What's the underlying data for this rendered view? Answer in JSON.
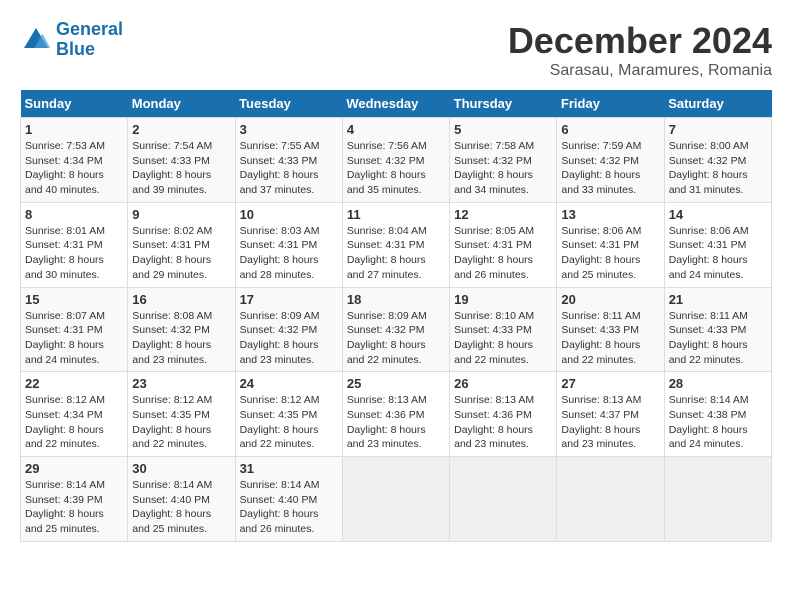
{
  "header": {
    "logo_line1": "General",
    "logo_line2": "Blue",
    "title": "December 2024",
    "subtitle": "Sarasau, Maramures, Romania"
  },
  "calendar": {
    "days_of_week": [
      "Sunday",
      "Monday",
      "Tuesday",
      "Wednesday",
      "Thursday",
      "Friday",
      "Saturday"
    ],
    "weeks": [
      [
        {
          "day": "",
          "detail": ""
        },
        {
          "day": "2",
          "detail": "Sunrise: 7:54 AM\nSunset: 4:33 PM\nDaylight: 8 hours\nand 39 minutes."
        },
        {
          "day": "3",
          "detail": "Sunrise: 7:55 AM\nSunset: 4:33 PM\nDaylight: 8 hours\nand 37 minutes."
        },
        {
          "day": "4",
          "detail": "Sunrise: 7:56 AM\nSunset: 4:32 PM\nDaylight: 8 hours\nand 35 minutes."
        },
        {
          "day": "5",
          "detail": "Sunrise: 7:58 AM\nSunset: 4:32 PM\nDaylight: 8 hours\nand 34 minutes."
        },
        {
          "day": "6",
          "detail": "Sunrise: 7:59 AM\nSunset: 4:32 PM\nDaylight: 8 hours\nand 33 minutes."
        },
        {
          "day": "7",
          "detail": "Sunrise: 8:00 AM\nSunset: 4:32 PM\nDaylight: 8 hours\nand 31 minutes."
        }
      ],
      [
        {
          "day": "1",
          "detail": "Sunrise: 7:53 AM\nSunset: 4:34 PM\nDaylight: 8 hours\nand 40 minutes."
        },
        null,
        null,
        null,
        null,
        null,
        null
      ],
      [
        {
          "day": "8",
          "detail": "Sunrise: 8:01 AM\nSunset: 4:31 PM\nDaylight: 8 hours\nand 30 minutes."
        },
        {
          "day": "9",
          "detail": "Sunrise: 8:02 AM\nSunset: 4:31 PM\nDaylight: 8 hours\nand 29 minutes."
        },
        {
          "day": "10",
          "detail": "Sunrise: 8:03 AM\nSunset: 4:31 PM\nDaylight: 8 hours\nand 28 minutes."
        },
        {
          "day": "11",
          "detail": "Sunrise: 8:04 AM\nSunset: 4:31 PM\nDaylight: 8 hours\nand 27 minutes."
        },
        {
          "day": "12",
          "detail": "Sunrise: 8:05 AM\nSunset: 4:31 PM\nDaylight: 8 hours\nand 26 minutes."
        },
        {
          "day": "13",
          "detail": "Sunrise: 8:06 AM\nSunset: 4:31 PM\nDaylight: 8 hours\nand 25 minutes."
        },
        {
          "day": "14",
          "detail": "Sunrise: 8:06 AM\nSunset: 4:31 PM\nDaylight: 8 hours\nand 24 minutes."
        }
      ],
      [
        {
          "day": "15",
          "detail": "Sunrise: 8:07 AM\nSunset: 4:31 PM\nDaylight: 8 hours\nand 24 minutes."
        },
        {
          "day": "16",
          "detail": "Sunrise: 8:08 AM\nSunset: 4:32 PM\nDaylight: 8 hours\nand 23 minutes."
        },
        {
          "day": "17",
          "detail": "Sunrise: 8:09 AM\nSunset: 4:32 PM\nDaylight: 8 hours\nand 23 minutes."
        },
        {
          "day": "18",
          "detail": "Sunrise: 8:09 AM\nSunset: 4:32 PM\nDaylight: 8 hours\nand 22 minutes."
        },
        {
          "day": "19",
          "detail": "Sunrise: 8:10 AM\nSunset: 4:33 PM\nDaylight: 8 hours\nand 22 minutes."
        },
        {
          "day": "20",
          "detail": "Sunrise: 8:11 AM\nSunset: 4:33 PM\nDaylight: 8 hours\nand 22 minutes."
        },
        {
          "day": "21",
          "detail": "Sunrise: 8:11 AM\nSunset: 4:33 PM\nDaylight: 8 hours\nand 22 minutes."
        }
      ],
      [
        {
          "day": "22",
          "detail": "Sunrise: 8:12 AM\nSunset: 4:34 PM\nDaylight: 8 hours\nand 22 minutes."
        },
        {
          "day": "23",
          "detail": "Sunrise: 8:12 AM\nSunset: 4:35 PM\nDaylight: 8 hours\nand 22 minutes."
        },
        {
          "day": "24",
          "detail": "Sunrise: 8:12 AM\nSunset: 4:35 PM\nDaylight: 8 hours\nand 22 minutes."
        },
        {
          "day": "25",
          "detail": "Sunrise: 8:13 AM\nSunset: 4:36 PM\nDaylight: 8 hours\nand 23 minutes."
        },
        {
          "day": "26",
          "detail": "Sunrise: 8:13 AM\nSunset: 4:36 PM\nDaylight: 8 hours\nand 23 minutes."
        },
        {
          "day": "27",
          "detail": "Sunrise: 8:13 AM\nSunset: 4:37 PM\nDaylight: 8 hours\nand 23 minutes."
        },
        {
          "day": "28",
          "detail": "Sunrise: 8:14 AM\nSunset: 4:38 PM\nDaylight: 8 hours\nand 24 minutes."
        }
      ],
      [
        {
          "day": "29",
          "detail": "Sunrise: 8:14 AM\nSunset: 4:39 PM\nDaylight: 8 hours\nand 25 minutes."
        },
        {
          "day": "30",
          "detail": "Sunrise: 8:14 AM\nSunset: 4:40 PM\nDaylight: 8 hours\nand 25 minutes."
        },
        {
          "day": "31",
          "detail": "Sunrise: 8:14 AM\nSunset: 4:40 PM\nDaylight: 8 hours\nand 26 minutes."
        },
        {
          "day": "",
          "detail": ""
        },
        {
          "day": "",
          "detail": ""
        },
        {
          "day": "",
          "detail": ""
        },
        {
          "day": "",
          "detail": ""
        }
      ]
    ]
  }
}
